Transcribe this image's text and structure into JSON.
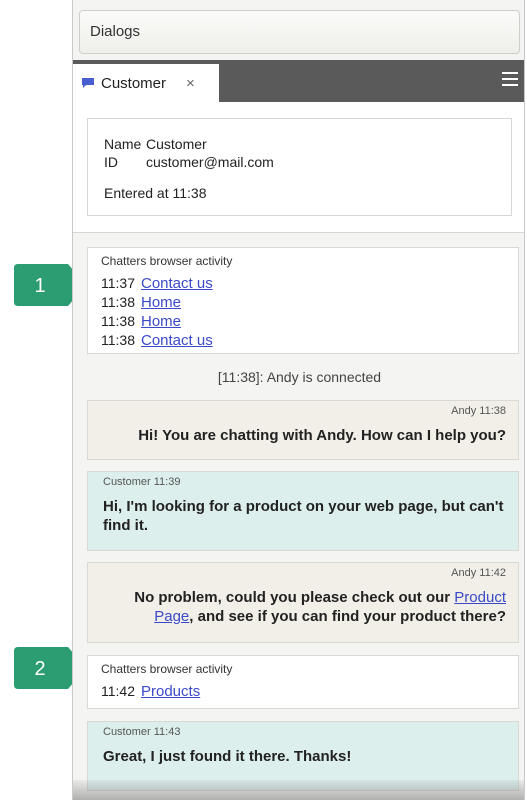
{
  "dialogs_title": "Dialogs",
  "tab": {
    "label": "Customer",
    "close": "×"
  },
  "customer_info": {
    "name_key": "Name",
    "name_value": "Customer",
    "id_key": "ID",
    "id_value": "customer@mail.com",
    "entered": "Entered at 11:38"
  },
  "activity1": {
    "title": "Chatters browser activity",
    "items": [
      {
        "time": "11:37",
        "link": "Contact us"
      },
      {
        "time": "11:38",
        "link": "Home"
      },
      {
        "time": "11:38",
        "link": "Home"
      },
      {
        "time": "11:38",
        "link": "Contact us"
      }
    ]
  },
  "system_msg": "[11:38]: Andy is connected",
  "messages": [
    {
      "meta": "Andy 11:38",
      "text": "Hi! You are chatting with Andy. How can I help you?"
    },
    {
      "meta": "Customer 11:39",
      "text": "Hi, I'm looking for a product on your web page, but can't find it."
    },
    {
      "meta": "Andy 11:42",
      "text_before": "No problem, could you please check out our ",
      "link": "Product Page",
      "text_after": ", and see if you can find your product there?"
    },
    {
      "meta": "Customer 11:43",
      "text": "Great, I just found it there. Thanks!"
    }
  ],
  "activity2": {
    "title": "Chatters browser activity",
    "items": [
      {
        "time": "11:42",
        "link": "Products"
      }
    ]
  },
  "callouts": [
    "1",
    "2"
  ],
  "colors": {
    "callout_green": "#2c9c72",
    "tab_bar": "#5a5a5a",
    "link": "#3a49c8",
    "agent_bg": "#f1efe7",
    "customer_bg": "#dcefed"
  }
}
